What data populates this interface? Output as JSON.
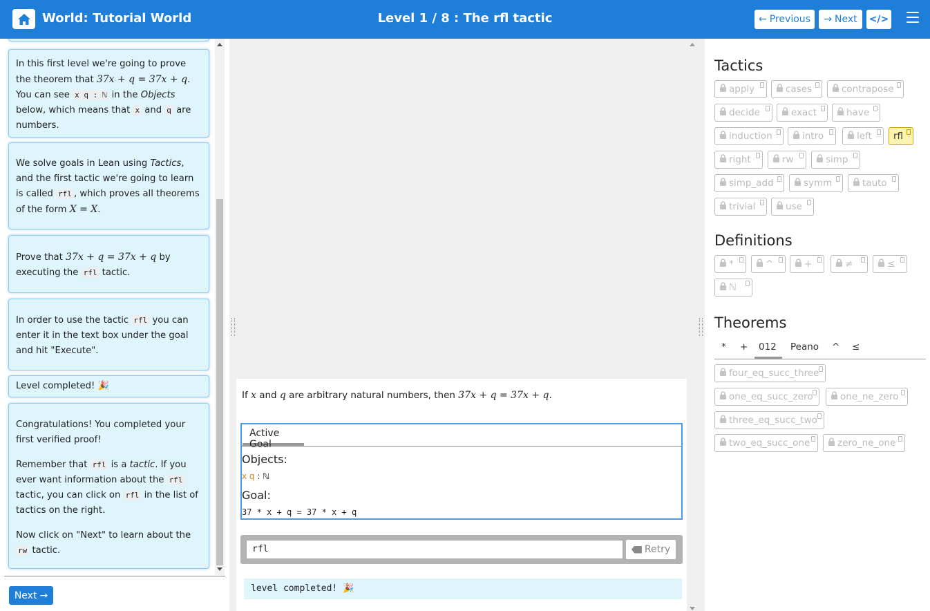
{
  "header": {
    "world_title": "World: Tutorial World",
    "level_title": "Level 1 / 8 : The rfl tactic",
    "previous_label": "Previous",
    "next_label": "Next",
    "brand_color": "#1f7fd8"
  },
  "left": {
    "card1": {
      "t1": "In this first level we're going to prove the theorem that ",
      "m1": "37x + q = 37x + q",
      "t2": ". You can see ",
      "c1": "x q : ℕ",
      "t3": " in the ",
      "e1": "Objects",
      "t4": " below, which means that ",
      "c2": "x",
      "t5": " and ",
      "c3": "q",
      "t6": " are numbers."
    },
    "card2": {
      "t1": "We solve goals in Lean using ",
      "e1": "Tactics",
      "t2": ", and the first tactic we're going to learn is called ",
      "c1": "rfl",
      "t3": ", which proves all theorems of the form ",
      "m1": "X = X",
      "t4": "."
    },
    "card3": {
      "t1": "Prove that ",
      "m1": "37x + q = 37x + q",
      "t2": " by executing the ",
      "c1": "rfl",
      "t3": " tactic."
    },
    "card4": {
      "t1": "In order to use the tactic ",
      "c1": "rfl",
      "t2": " you can enter it in the text box under the goal and hit \"Execute\"."
    },
    "card5": {
      "text": "Level completed! 🎉"
    },
    "card6": {
      "p1": "Congratulations! You completed your first verified proof!",
      "p2a": "Remember that ",
      "p2c1": "rfl",
      "p2b": " is a ",
      "p2e": "tactic",
      "p2c": ". If you ever want information about the ",
      "p2c2": "rfl",
      "p2d": " tactic, you can click on ",
      "p2c3": "rfl",
      "p2f": " in the list of tactics on the right.",
      "p3a": "Now click on \"Next\" to learn about the ",
      "p3c": "rw",
      "p3b": " tactic."
    },
    "next_button": "Next"
  },
  "center": {
    "statement": {
      "t1": "If ",
      "m1": "x",
      "t2": " and ",
      "m2": "q",
      "t3": " are arbitrary natural numbers, then ",
      "m3": "37x + q = 37x + q",
      "t4": "."
    },
    "active_goal_tab": "Active Goal",
    "objects_label": "Objects:",
    "objects_vars": "x q",
    "objects_type": " : ℕ",
    "goal_label": "Goal:",
    "goal_text": "37 * x + q = 37 * x + q",
    "input_value": "rfl",
    "retry_label": "Retry",
    "completed_text": "level completed! 🎉"
  },
  "right": {
    "tactics_title": "Tactics",
    "tactics": [
      "apply",
      "cases",
      "contrapose",
      "decide",
      "exact",
      "have",
      "induction",
      "intro",
      "left",
      "rfl",
      "right",
      "rw",
      "simp",
      "simp_add",
      "symm",
      "tauto",
      "trivial",
      "use"
    ],
    "definitions_title": "Definitions",
    "definitions": [
      "*",
      "^",
      "+",
      "≠",
      "≤",
      "ℕ"
    ],
    "theorems_title": "Theorems",
    "theorem_tabs": [
      "*",
      "+",
      "012",
      "Peano",
      "^",
      "≤"
    ],
    "theorems": [
      "four_eq_succ_three",
      "one_eq_succ_zero",
      "one_ne_zero",
      "three_eq_succ_two",
      "two_eq_succ_one",
      "zero_ne_one"
    ]
  }
}
